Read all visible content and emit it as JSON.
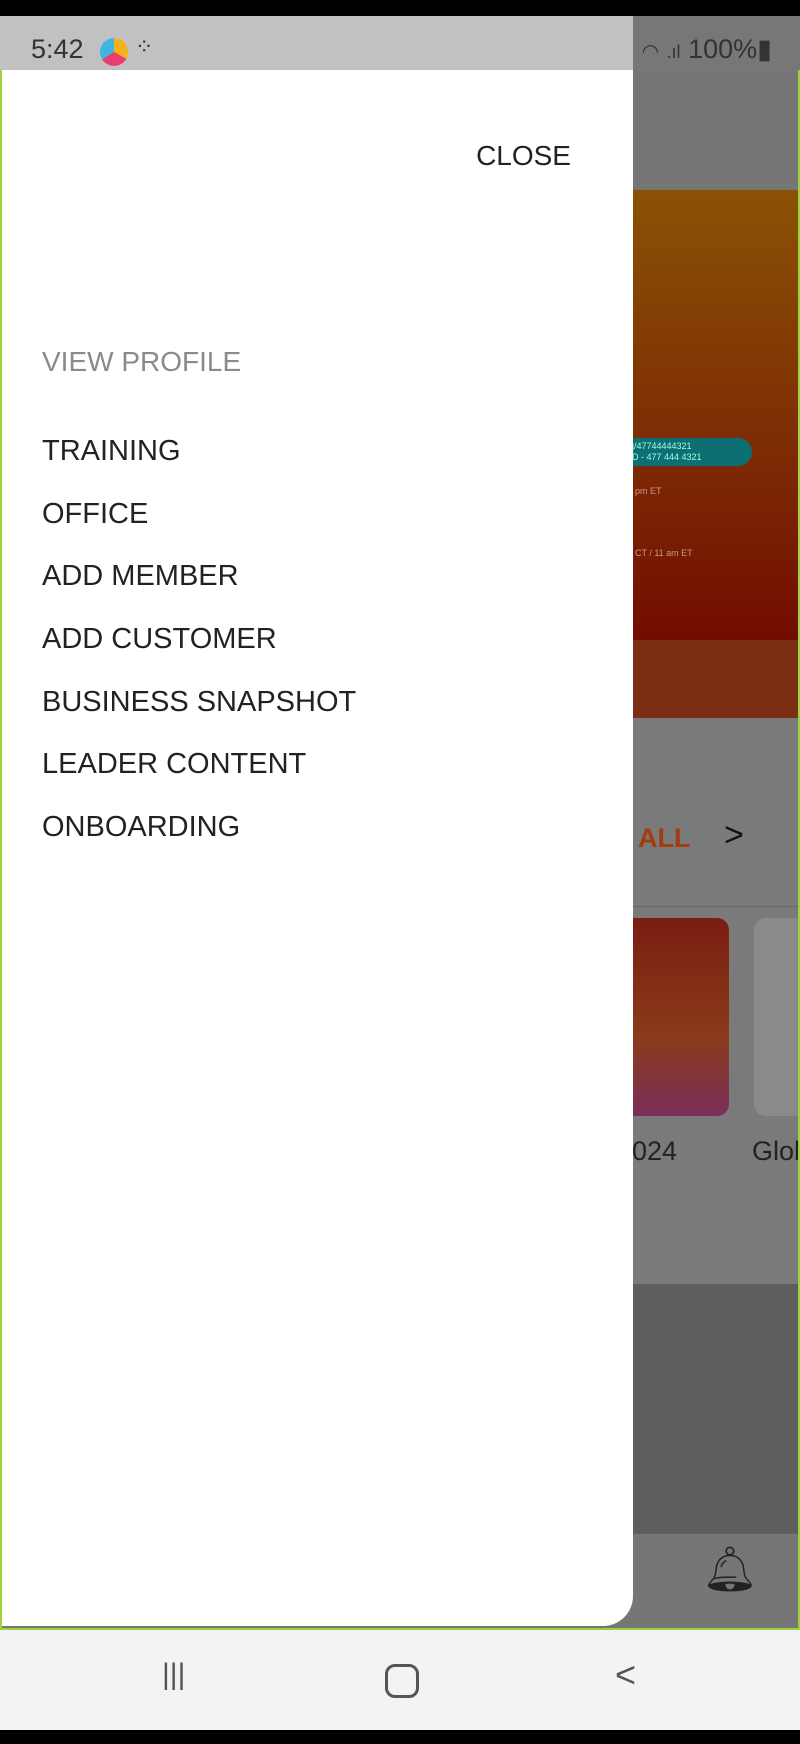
{
  "status_bar": {
    "time": "5:42",
    "battery": "100%",
    "icons": [
      "app-icon",
      "download-icon",
      "wifi-icon",
      "signal-icon",
      "battery-icon"
    ]
  },
  "drawer": {
    "close_label": "CLOSE",
    "view_profile": "VIEW PROFILE",
    "items": [
      {
        "label": "TRAINING"
      },
      {
        "label": "OFFICE"
      },
      {
        "label": "ADD MEMBER"
      },
      {
        "label": "ADD CUSTOMER"
      },
      {
        "label": "BUSINESS SNAPSHOT"
      },
      {
        "label": "LEADER CONTENT"
      },
      {
        "label": "ONBOARDING"
      }
    ]
  },
  "background": {
    "pill_line1": "j/47744444321",
    "pill_line2": "D - 477 444 4321",
    "banner_text1": "pm ET",
    "banner_text2": "CT / 11 am ET",
    "see_all": "ALL",
    "card1_caption": "024",
    "card2_caption": "Glol"
  },
  "nav_bar": {
    "icons": [
      "recent-apps-icon",
      "home-icon",
      "back-icon"
    ]
  }
}
